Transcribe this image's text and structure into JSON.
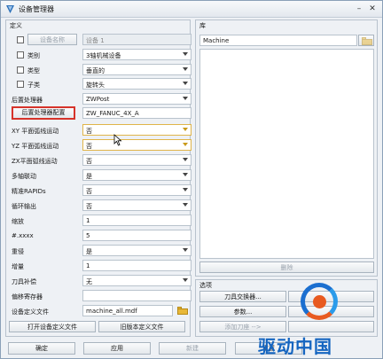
{
  "window": {
    "title": "设备管理器"
  },
  "define_group": {
    "title": "定义",
    "name_button": "设备名称",
    "name_value": "设备 1",
    "rows": [
      {
        "label": "类别",
        "value": "3轴机械设备",
        "checkbox": true,
        "type": "dropdown"
      },
      {
        "label": "类型",
        "value": "垂直的",
        "checkbox": true,
        "type": "dropdown"
      },
      {
        "label": "子类",
        "value": "旋转头",
        "checkbox": true,
        "type": "dropdown"
      },
      {
        "label": "后置处理器",
        "value": "ZWPost",
        "checkbox": false,
        "type": "dropdown"
      }
    ],
    "post_config_button": "后置处理器配置",
    "post_config_value": "ZW_FANUC_4X_A",
    "param_rows": [
      {
        "label": "XY 平面弧线运动",
        "value": "否",
        "type": "dropdown",
        "highlight": true
      },
      {
        "label": "YZ 平面弧线运动",
        "value": "否",
        "type": "dropdown",
        "highlight": true
      },
      {
        "label": "ZX平面弧线运动",
        "value": "否",
        "type": "dropdown",
        "highlight": false
      },
      {
        "label": "多轴联动",
        "value": "是",
        "type": "dropdown",
        "highlight": false
      },
      {
        "label": "精准RAPIDs",
        "value": "否",
        "type": "dropdown",
        "highlight": false
      },
      {
        "label": "循环输出",
        "value": "否",
        "type": "dropdown",
        "highlight": false
      },
      {
        "label": "缩放",
        "value": "1",
        "type": "text",
        "highlight": false
      },
      {
        "label": "#.xxxx",
        "value": "5",
        "type": "text",
        "highlight": false
      },
      {
        "label": "重侵",
        "value": "是",
        "type": "dropdown",
        "highlight": false
      },
      {
        "label": "增量",
        "value": "1",
        "type": "text",
        "highlight": false
      },
      {
        "label": "刀具补偿",
        "value": "无",
        "type": "dropdown",
        "highlight": false
      },
      {
        "label": "偏移寄存器",
        "value": "",
        "type": "text",
        "highlight": false
      }
    ],
    "definition_file_label": "设备定义文件",
    "definition_file_value": "machine_all.mdf",
    "open_button": "打开设备定义文件",
    "old_version_button": "旧版本定义文件"
  },
  "library_group": {
    "title": "库",
    "search_value": "Machine",
    "delete_button": "删除"
  },
  "options_group": {
    "title": "选项",
    "tool_changer_button": "刀具交换器...",
    "param_button": "参数...",
    "add_button": "添加刀座 -->",
    "right_button_1": "",
    "right_button_2": "",
    "right_button_3": ""
  },
  "footer": {
    "ok_button": "确定",
    "apply_button": "应用",
    "new_button": "新建",
    "reset_button": "重置"
  },
  "watermark": {
    "text": "驱动中国"
  }
}
